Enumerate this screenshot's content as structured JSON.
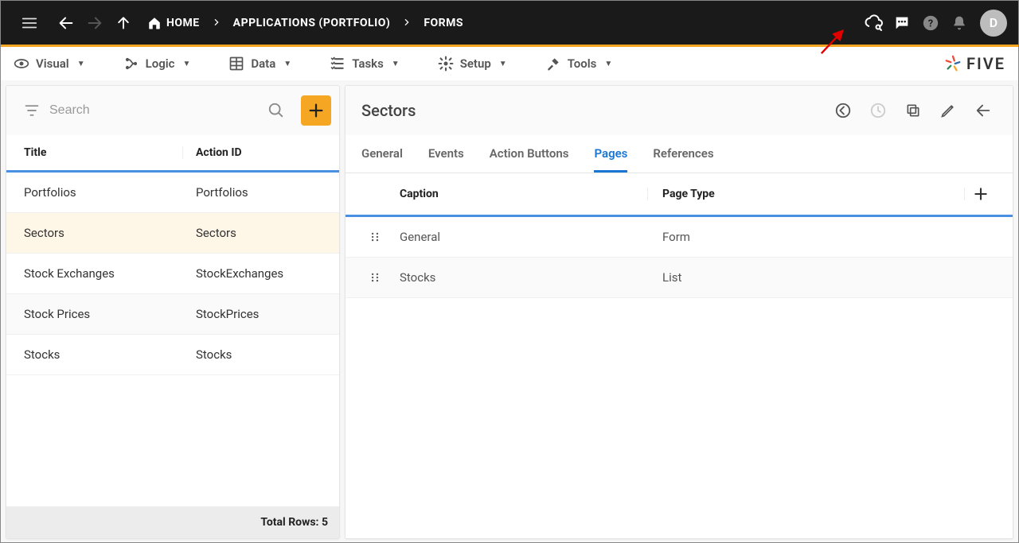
{
  "topbar": {
    "breadcrumb": [
      {
        "label": "HOME"
      },
      {
        "label": "APPLICATIONS (PORTFOLIO)"
      },
      {
        "label": "FORMS"
      }
    ],
    "avatar_initial": "D"
  },
  "menubar": {
    "items": [
      {
        "label": "Visual",
        "icon": "eye"
      },
      {
        "label": "Logic",
        "icon": "logic"
      },
      {
        "label": "Data",
        "icon": "grid"
      },
      {
        "label": "Tasks",
        "icon": "list"
      },
      {
        "label": "Setup",
        "icon": "gear"
      },
      {
        "label": "Tools",
        "icon": "wrench"
      }
    ],
    "brand": "FIVE"
  },
  "left": {
    "search_placeholder": "Search",
    "columns": {
      "title": "Title",
      "action_id": "Action ID"
    },
    "rows": [
      {
        "title": "Portfolios",
        "action_id": "Portfolios",
        "selected": false
      },
      {
        "title": "Sectors",
        "action_id": "Sectors",
        "selected": true
      },
      {
        "title": "Stock Exchanges",
        "action_id": "StockExchanges",
        "selected": false
      },
      {
        "title": "Stock Prices",
        "action_id": "StockPrices",
        "selected": false
      },
      {
        "title": "Stocks",
        "action_id": "Stocks",
        "selected": false
      }
    ],
    "footer": "Total Rows: 5"
  },
  "right": {
    "title": "Sectors",
    "tabs": [
      {
        "label": "General",
        "active": false
      },
      {
        "label": "Events",
        "active": false
      },
      {
        "label": "Action Buttons",
        "active": false
      },
      {
        "label": "Pages",
        "active": true
      },
      {
        "label": "References",
        "active": false
      }
    ],
    "pages_columns": {
      "caption": "Caption",
      "page_type": "Page Type"
    },
    "pages": [
      {
        "caption": "General",
        "page_type": "Form"
      },
      {
        "caption": "Stocks",
        "page_type": "List"
      }
    ]
  }
}
